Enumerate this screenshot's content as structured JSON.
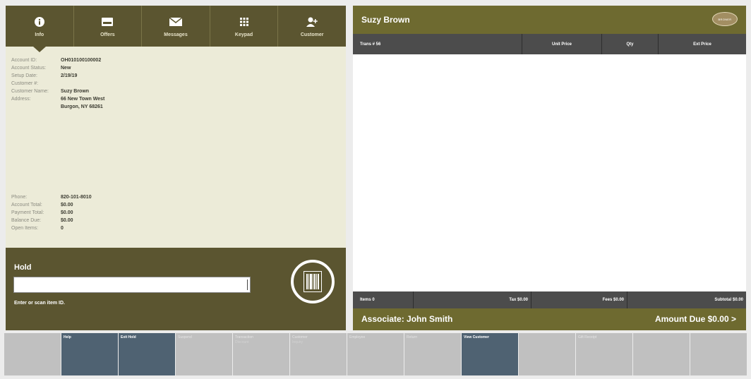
{
  "tabs": [
    {
      "label": "Info",
      "icon": "info-icon"
    },
    {
      "label": "Offers",
      "icon": "offers-icon"
    },
    {
      "label": "Messages",
      "icon": "envelope-icon"
    },
    {
      "label": "Keypad",
      "icon": "keypad-icon"
    },
    {
      "label": "Customer",
      "icon": "add-customer-icon"
    }
  ],
  "account": [
    {
      "key": "Account ID:",
      "value": "OH010100100002"
    },
    {
      "key": "Account Status:",
      "value": "New"
    },
    {
      "key": "Setup Date:",
      "value": "2/19/19"
    },
    {
      "key": "Customer #:",
      "value": ""
    },
    {
      "key": "Customer Name:",
      "value": "Suzy Brown"
    },
    {
      "key": "Address:",
      "value": "66 New Town West",
      "value2": "Burgon, NY 68261"
    }
  ],
  "balances": [
    {
      "key": "Phone:",
      "value": "820-101-8010"
    },
    {
      "key": "Account Total:",
      "value": "$0.00"
    },
    {
      "key": "Payment Total:",
      "value": "$0.00"
    },
    {
      "key": "Balance Due:",
      "value": "$0.00"
    },
    {
      "key": "Open Items:",
      "value": "0"
    }
  ],
  "hold": {
    "title": "Hold",
    "hint": "Enter or scan item ID.",
    "value": ""
  },
  "transaction": {
    "customer_name": "Suzy Brown",
    "logo_text": "BRONER",
    "columns": [
      "Trans # 56",
      "Unit Price",
      "Qty",
      "Ext Price"
    ],
    "footer": {
      "items": "Items 0",
      "tax": "Tax $0.00",
      "fees": "Fees $0.00",
      "subtotal": "Subtotal $0.00"
    },
    "associate": "Associate: John Smith",
    "amount_due": "Amount Due  $0.00  >"
  },
  "function_keys": [
    {
      "label": "",
      "sub": "",
      "active": false
    },
    {
      "label": "Help",
      "sub": "",
      "active": true
    },
    {
      "label": "Exit Hold",
      "sub": "",
      "active": true
    },
    {
      "label": "Suspend",
      "sub": "",
      "active": false
    },
    {
      "label": "Transaction",
      "sub": "Discount",
      "active": false
    },
    {
      "label": "Customer",
      "sub": "Inquiry",
      "active": false
    },
    {
      "label": "Employee",
      "sub": "",
      "active": false
    },
    {
      "label": "Return",
      "sub": "",
      "active": false
    },
    {
      "label": "View Customer",
      "sub": "",
      "active": true
    },
    {
      "label": "",
      "sub": "",
      "active": false
    },
    {
      "label": "Gift Receipt",
      "sub": "",
      "active": false
    },
    {
      "label": "",
      "sub": "",
      "active": false
    },
    {
      "label": "",
      "sub": "",
      "active": false
    }
  ],
  "colors": {
    "olive_dark": "#5b5530",
    "olive": "#6e6a30",
    "cream": "#ecebd8",
    "table_header": "#4c4c4c",
    "fkey_active": "#4f6272",
    "fkey": "#c0c0c0"
  }
}
